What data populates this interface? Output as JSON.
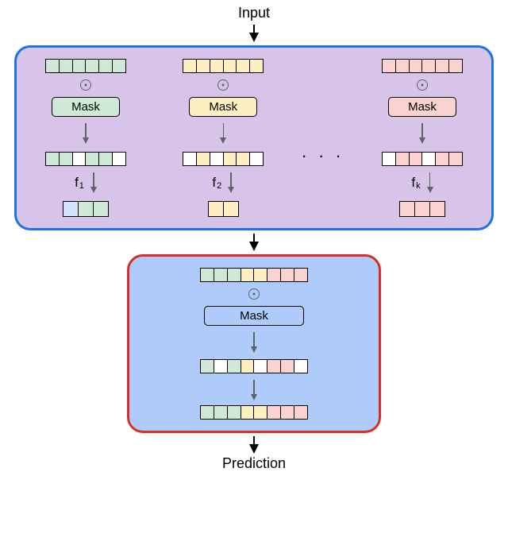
{
  "labels": {
    "input": "Input",
    "prediction": "Prediction",
    "mask": "Mask",
    "dots": "· · ·"
  },
  "branches": {
    "f1": "f",
    "f1_sub": "1",
    "f2": "f",
    "f2_sub": "2",
    "fk": "f",
    "fk_sub": "k"
  },
  "patterns": {
    "green_input": [
      1,
      1,
      1,
      1,
      1,
      1
    ],
    "green_masked": [
      1,
      1,
      0,
      1,
      1,
      0
    ],
    "green_embed": 3,
    "yellow_input": [
      1,
      1,
      1,
      1,
      1,
      1
    ],
    "yellow_masked": [
      0,
      1,
      0,
      1,
      1,
      0
    ],
    "yellow_embed": 2,
    "pink_input": [
      1,
      1,
      1,
      1,
      1,
      1
    ],
    "pink_masked": [
      0,
      1,
      1,
      0,
      1,
      1
    ],
    "pink_embed": 3,
    "fusion_concat": [
      "cg",
      "cg",
      "cg",
      "cy",
      "cy",
      "cp",
      "cp",
      "cp"
    ],
    "fusion_masked": [
      "cg",
      "cw",
      "cg",
      "cy",
      "cw",
      "cp",
      "cp",
      "cw"
    ],
    "fusion_final": [
      "cg",
      "cg",
      "cg",
      "cy",
      "cy",
      "cp",
      "cp",
      "cp"
    ]
  }
}
